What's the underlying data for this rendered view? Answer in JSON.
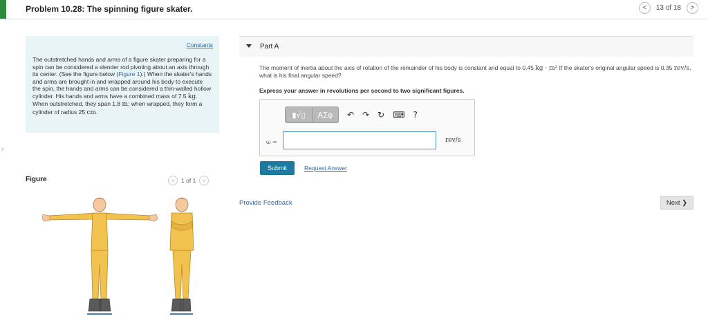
{
  "header": {
    "title": "Problem 10.28: The spinning figure skater.",
    "prev_icon": "<",
    "next_icon": ">",
    "count": "13 of 18"
  },
  "problem": {
    "constants_label": "Constants",
    "text_part1": "The outstretched hands and arms of a figure skater preparing for a spin can be considered a slender rod pivoting about an axis through its center. (See the figure below (",
    "figure_link": "Figure 1",
    "text_part2": ").) When the skater's hands and arms are brought in and wrapped around his body to execute the spin, the hands and arms can be considered a thin-walled hollow cylinder. His hands and arms have a combined mass of ",
    "mass_value": "7.5",
    "mass_unit": "kg",
    "text_part3": ". When outstretched, they span ",
    "span_value": "1.8",
    "span_unit": "m",
    "text_part4": "; when wrapped, they form a cylinder of radius ",
    "radius_value": "25",
    "radius_unit": "cm",
    "text_part5": "."
  },
  "figure": {
    "label": "Figure",
    "count": "1 of 1",
    "prev_icon": "<",
    "next_icon": ">"
  },
  "part": {
    "title": "Part A",
    "question_part1": "The moment of inertia about the axis of rotation of the remainder of his body is constant and equal to ",
    "inertia_value": "0.45",
    "inertia_unit": "kg · m²",
    "question_part2": " If the skater's original angular speed is ",
    "speed_value": "0.35",
    "speed_unit": "rev/s",
    "question_part3": ", what is his final angular speed?",
    "instruction": "Express your answer in revolutions per second to two significant figures."
  },
  "answer": {
    "toolbar": {
      "templates_label": "▮√▯",
      "symbols_label": "ΑΣφ",
      "undo_icon": "↶",
      "redo_icon": "↷",
      "reset_icon": "↻",
      "keyboard_icon": "⌨",
      "help_icon": "?"
    },
    "variable_label": "ω =",
    "value": "",
    "unit": "rev/s"
  },
  "actions": {
    "submit_label": "Submit",
    "request_label": "Request Answer",
    "feedback_label": "Provide Feedback",
    "next_label": "Next ❯"
  },
  "colors": {
    "accent_green": "#2e8b3e",
    "problem_bg": "#e8f4f6",
    "link_blue": "#2a6ab3",
    "submit_bg": "#1d7a9e",
    "skater_yellow": "#f2c24e"
  }
}
